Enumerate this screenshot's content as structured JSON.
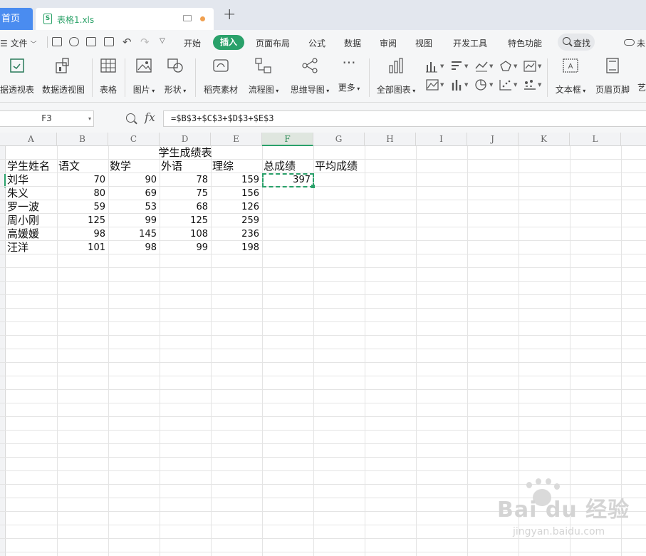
{
  "tabs": {
    "home": "首页",
    "document": "表格1.xls",
    "doc_icon": "S"
  },
  "menu": {
    "file": "文件",
    "items": [
      "开始",
      "插入",
      "页面布局",
      "公式",
      "数据",
      "审阅",
      "视图",
      "开发工具",
      "特色功能"
    ],
    "active": "插入",
    "search": "查找",
    "cut_label": "未"
  },
  "ribbon": {
    "pivot_table": "据透视表",
    "pivot_chart": "数据透视图",
    "table": "表格",
    "picture": "图片",
    "shape": "形状",
    "assets": "稻壳素材",
    "flowchart": "流程图",
    "mindmap": "思维导图",
    "more": "更多",
    "all_charts": "全部图表",
    "textbox": "文本框",
    "header_footer": "页眉页脚",
    "art_cut": "艺"
  },
  "formula_bar": {
    "cell_ref": "F3",
    "fx": "fx",
    "formula": "=$B$3+$C$3+$D$3+$E$3"
  },
  "sheet": {
    "columns": [
      "A",
      "B",
      "C",
      "D",
      "E",
      "F",
      "G",
      "H",
      "I",
      "J",
      "K",
      "L"
    ],
    "selected_column": "F",
    "title": "学生成绩表",
    "headers": [
      "学生姓名",
      "语文",
      "数学",
      "外语",
      "理综",
      "总成绩",
      "平均成绩"
    ],
    "rows": [
      {
        "name": "刘华",
        "chinese": "70",
        "math": "90",
        "english": "78",
        "science": "159",
        "total": "397"
      },
      {
        "name": "朱义",
        "chinese": "80",
        "math": "69",
        "english": "75",
        "science": "156",
        "total": ""
      },
      {
        "name": "罗一波",
        "chinese": "59",
        "math": "53",
        "english": "68",
        "science": "126",
        "total": ""
      },
      {
        "name": "周小刚",
        "chinese": "125",
        "math": "99",
        "english": "125",
        "science": "259",
        "total": ""
      },
      {
        "name": "高媛媛",
        "chinese": "98",
        "math": "145",
        "english": "108",
        "science": "236",
        "total": ""
      },
      {
        "name": "汪洋",
        "chinese": "101",
        "math": "98",
        "english": "99",
        "science": "198",
        "total": ""
      }
    ]
  },
  "watermark": {
    "brand": "Bai du 经验",
    "url": "jingyan.baidu.com"
  },
  "colors": {
    "accent_green": "#2aa16a",
    "home_tab_blue": "#4a8cf0"
  }
}
